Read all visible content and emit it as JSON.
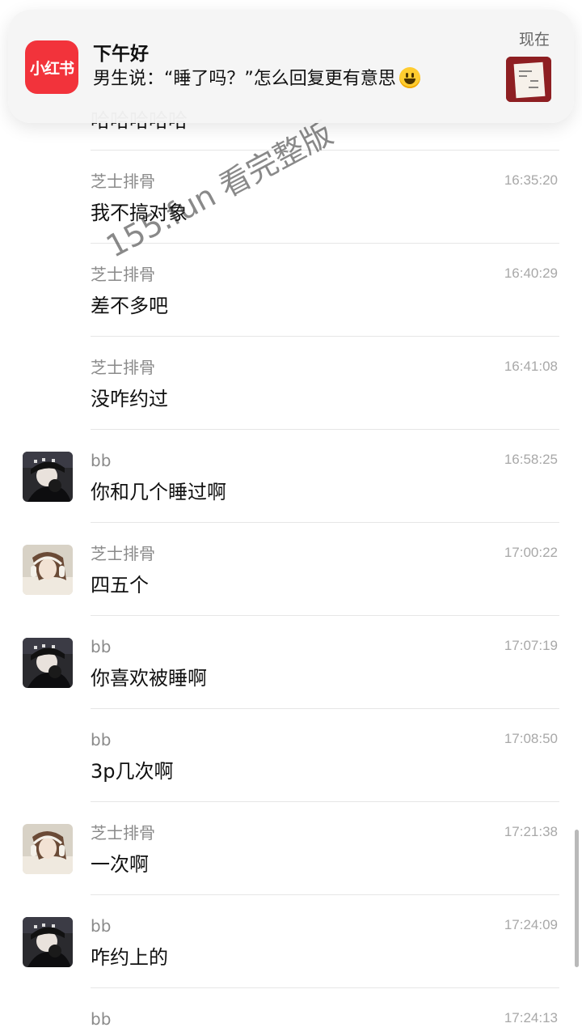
{
  "notification": {
    "app_icon_text": "小红书",
    "title": "下午好",
    "body": "男生说：“睡了吗？”怎么回复更有意思",
    "time": "现在",
    "emoji": "grinning-face",
    "accent": "#f2333b"
  },
  "peek_row": {
    "text": "哈哈哈哈哈"
  },
  "watermark": "155.fun 看完整版",
  "messages": [
    {
      "name": "芝士排骨",
      "time": "16:35:20",
      "text": "我不搞对象",
      "avatar": "none"
    },
    {
      "name": "芝士排骨",
      "time": "16:40:29",
      "text": "差不多吧",
      "avatar": "none"
    },
    {
      "name": "芝士排骨",
      "time": "16:41:08",
      "text": "没咋约过",
      "avatar": "none"
    },
    {
      "name": "bb",
      "time": "16:58:25",
      "text": "你和几个睡过啊",
      "avatar": "bb"
    },
    {
      "name": "芝士排骨",
      "time": "17:00:22",
      "text": "四五个",
      "avatar": "girl"
    },
    {
      "name": "bb",
      "time": "17:07:19",
      "text": "你喜欢被睡啊",
      "avatar": "bb"
    },
    {
      "name": "bb",
      "time": "17:08:50",
      "text": "3p几次啊",
      "avatar": "none"
    },
    {
      "name": "芝士排骨",
      "time": "17:21:38",
      "text": "一次啊",
      "avatar": "girl"
    },
    {
      "name": "bb",
      "time": "17:24:09",
      "text": "咋约上的",
      "avatar": "bb"
    },
    {
      "name": "bb",
      "time": "17:24:13",
      "text": "",
      "avatar": "none"
    }
  ]
}
